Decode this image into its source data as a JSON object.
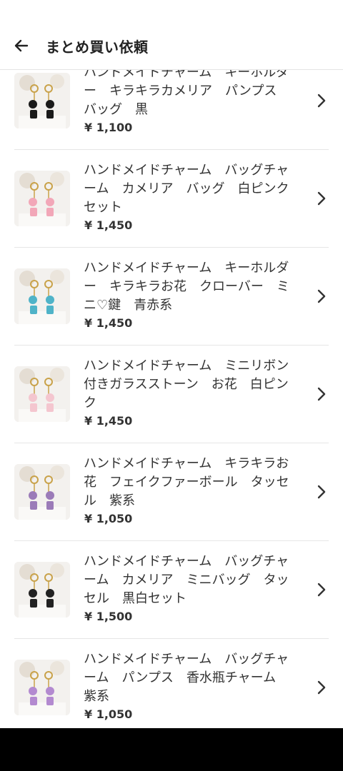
{
  "header": {
    "back_icon": "arrow-left-icon",
    "title": "まとめ買い依頼"
  },
  "items": [
    {
      "title": "ハンドメイドチャーム　キーホルダー　キラキラカメリア　パンプス　バッグ　黒",
      "price": "¥ 1,100",
      "accent": "#1a1a1a"
    },
    {
      "title": "ハンドメイドチャーム　バッグチャーム　カメリア　バッグ　白ピンクセット",
      "price": "¥ 1,450",
      "accent": "#f2a7b8"
    },
    {
      "title": "ハンドメイドチャーム　キーホルダー　キラキラお花　クローバー　ミニ♡鍵　青赤系",
      "price": "¥ 1,450",
      "accent": "#4fb3c8"
    },
    {
      "title": "ハンドメイドチャーム　ミニリボン付きガラスストーン　お花　白ピンク",
      "price": "¥ 1,450",
      "accent": "#f4c6cf"
    },
    {
      "title": "ハンドメイドチャーム　キラキラお花　フェイクファーボール　タッセル　紫系",
      "price": "¥ 1,050",
      "accent": "#9b7bb8"
    },
    {
      "title": "ハンドメイドチャーム　バッグチャーム　カメリア　ミニバッグ　タッセル　黒白セット",
      "price": "¥ 1,500",
      "accent": "#222222"
    },
    {
      "title": "ハンドメイドチャーム　バッグチャーム　パンプス　香水瓶チャーム　紫系",
      "price": "¥ 1,050",
      "accent": "#b38ad0"
    }
  ],
  "chevron_icon": "chevron-right-icon"
}
